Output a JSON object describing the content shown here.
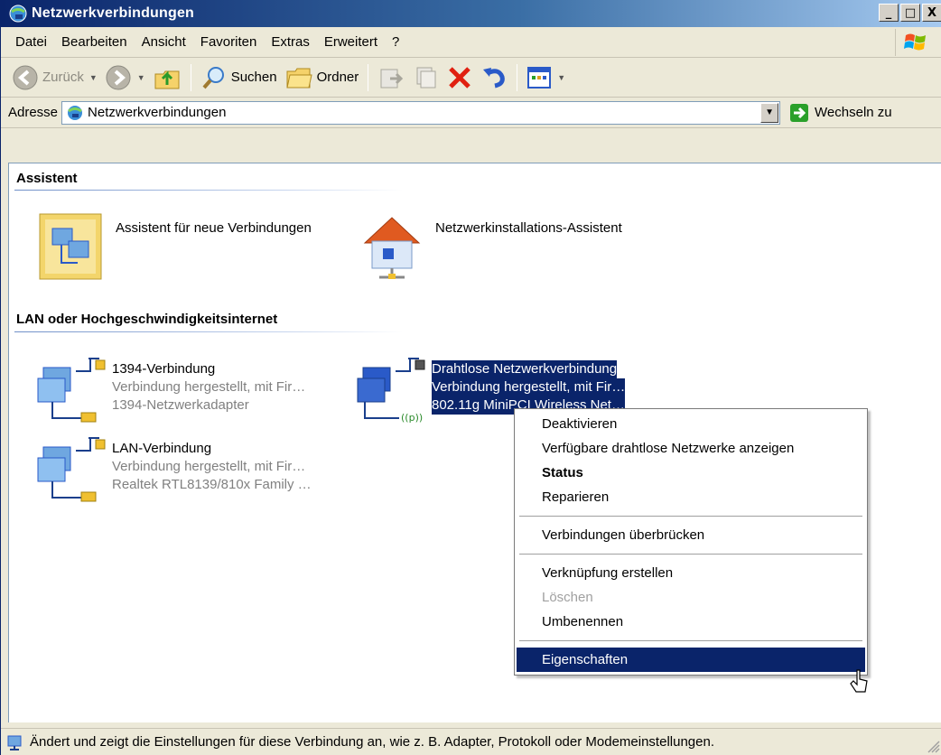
{
  "window": {
    "title": "Netzwerkverbindungen",
    "buttons": {
      "minimize": "_",
      "maximize": "□",
      "close": "X"
    }
  },
  "menubar": {
    "items": [
      "Datei",
      "Bearbeiten",
      "Ansicht",
      "Favoriten",
      "Extras",
      "Erweitert",
      "?"
    ]
  },
  "toolbar": {
    "back_label": "Zurück",
    "search_label": "Suchen",
    "folders_label": "Ordner"
  },
  "addressbar": {
    "label": "Adresse",
    "value": "Netzwerkverbindungen",
    "go_label": "Wechseln zu"
  },
  "groups": [
    {
      "title": "Assistent"
    },
    {
      "title": "LAN oder Hochgeschwindigkeitsinternet"
    }
  ],
  "wizards": [
    {
      "label": "Assistent für neue Verbindungen",
      "icon": "new-connection-wizard-icon"
    },
    {
      "label": "Netzwerkinstallations-Assistent",
      "icon": "network-setup-wizard-icon"
    }
  ],
  "connections": [
    {
      "name": "1394-Verbindung",
      "status": "Verbindung hergestellt, mit Fir…",
      "device": "1394-Netzwerkadapter",
      "icon": "lan-connection-icon"
    },
    {
      "name": "Drahtlose Netzwerkverbindung",
      "status": "Verbindung hergestellt, mit Fir…",
      "device": "802.11g MiniPCI Wireless Net…",
      "icon": "wireless-connection-icon",
      "selected": true
    },
    {
      "name": "LAN-Verbindung",
      "status": "Verbindung hergestellt, mit Fir…",
      "device": "Realtek RTL8139/810x Family …",
      "icon": "lan-connection-icon"
    }
  ],
  "context_menu": {
    "items": [
      {
        "label": "Deaktivieren"
      },
      {
        "label": "Verfügbare drahtlose Netzwerke anzeigen"
      },
      {
        "label": "Status",
        "bold": true
      },
      {
        "label": "Reparieren"
      },
      {
        "label": "Verbindungen überbrücken"
      },
      {
        "label": "Verknüpfung erstellen"
      },
      {
        "label": "Löschen",
        "disabled": true
      },
      {
        "label": "Umbenennen"
      },
      {
        "label": "Eigenschaften",
        "highlighted": true
      }
    ]
  },
  "statusbar": {
    "text": "Ändert und zeigt die Einstellungen für diese Verbindung an, wie z. B. Adapter, Protokoll oder Modemeinstellungen."
  },
  "colors": {
    "titlebar_start": "#0a246a",
    "titlebar_end": "#a6caf0",
    "selection": "#0a246a",
    "chrome": "#ece9d8"
  }
}
